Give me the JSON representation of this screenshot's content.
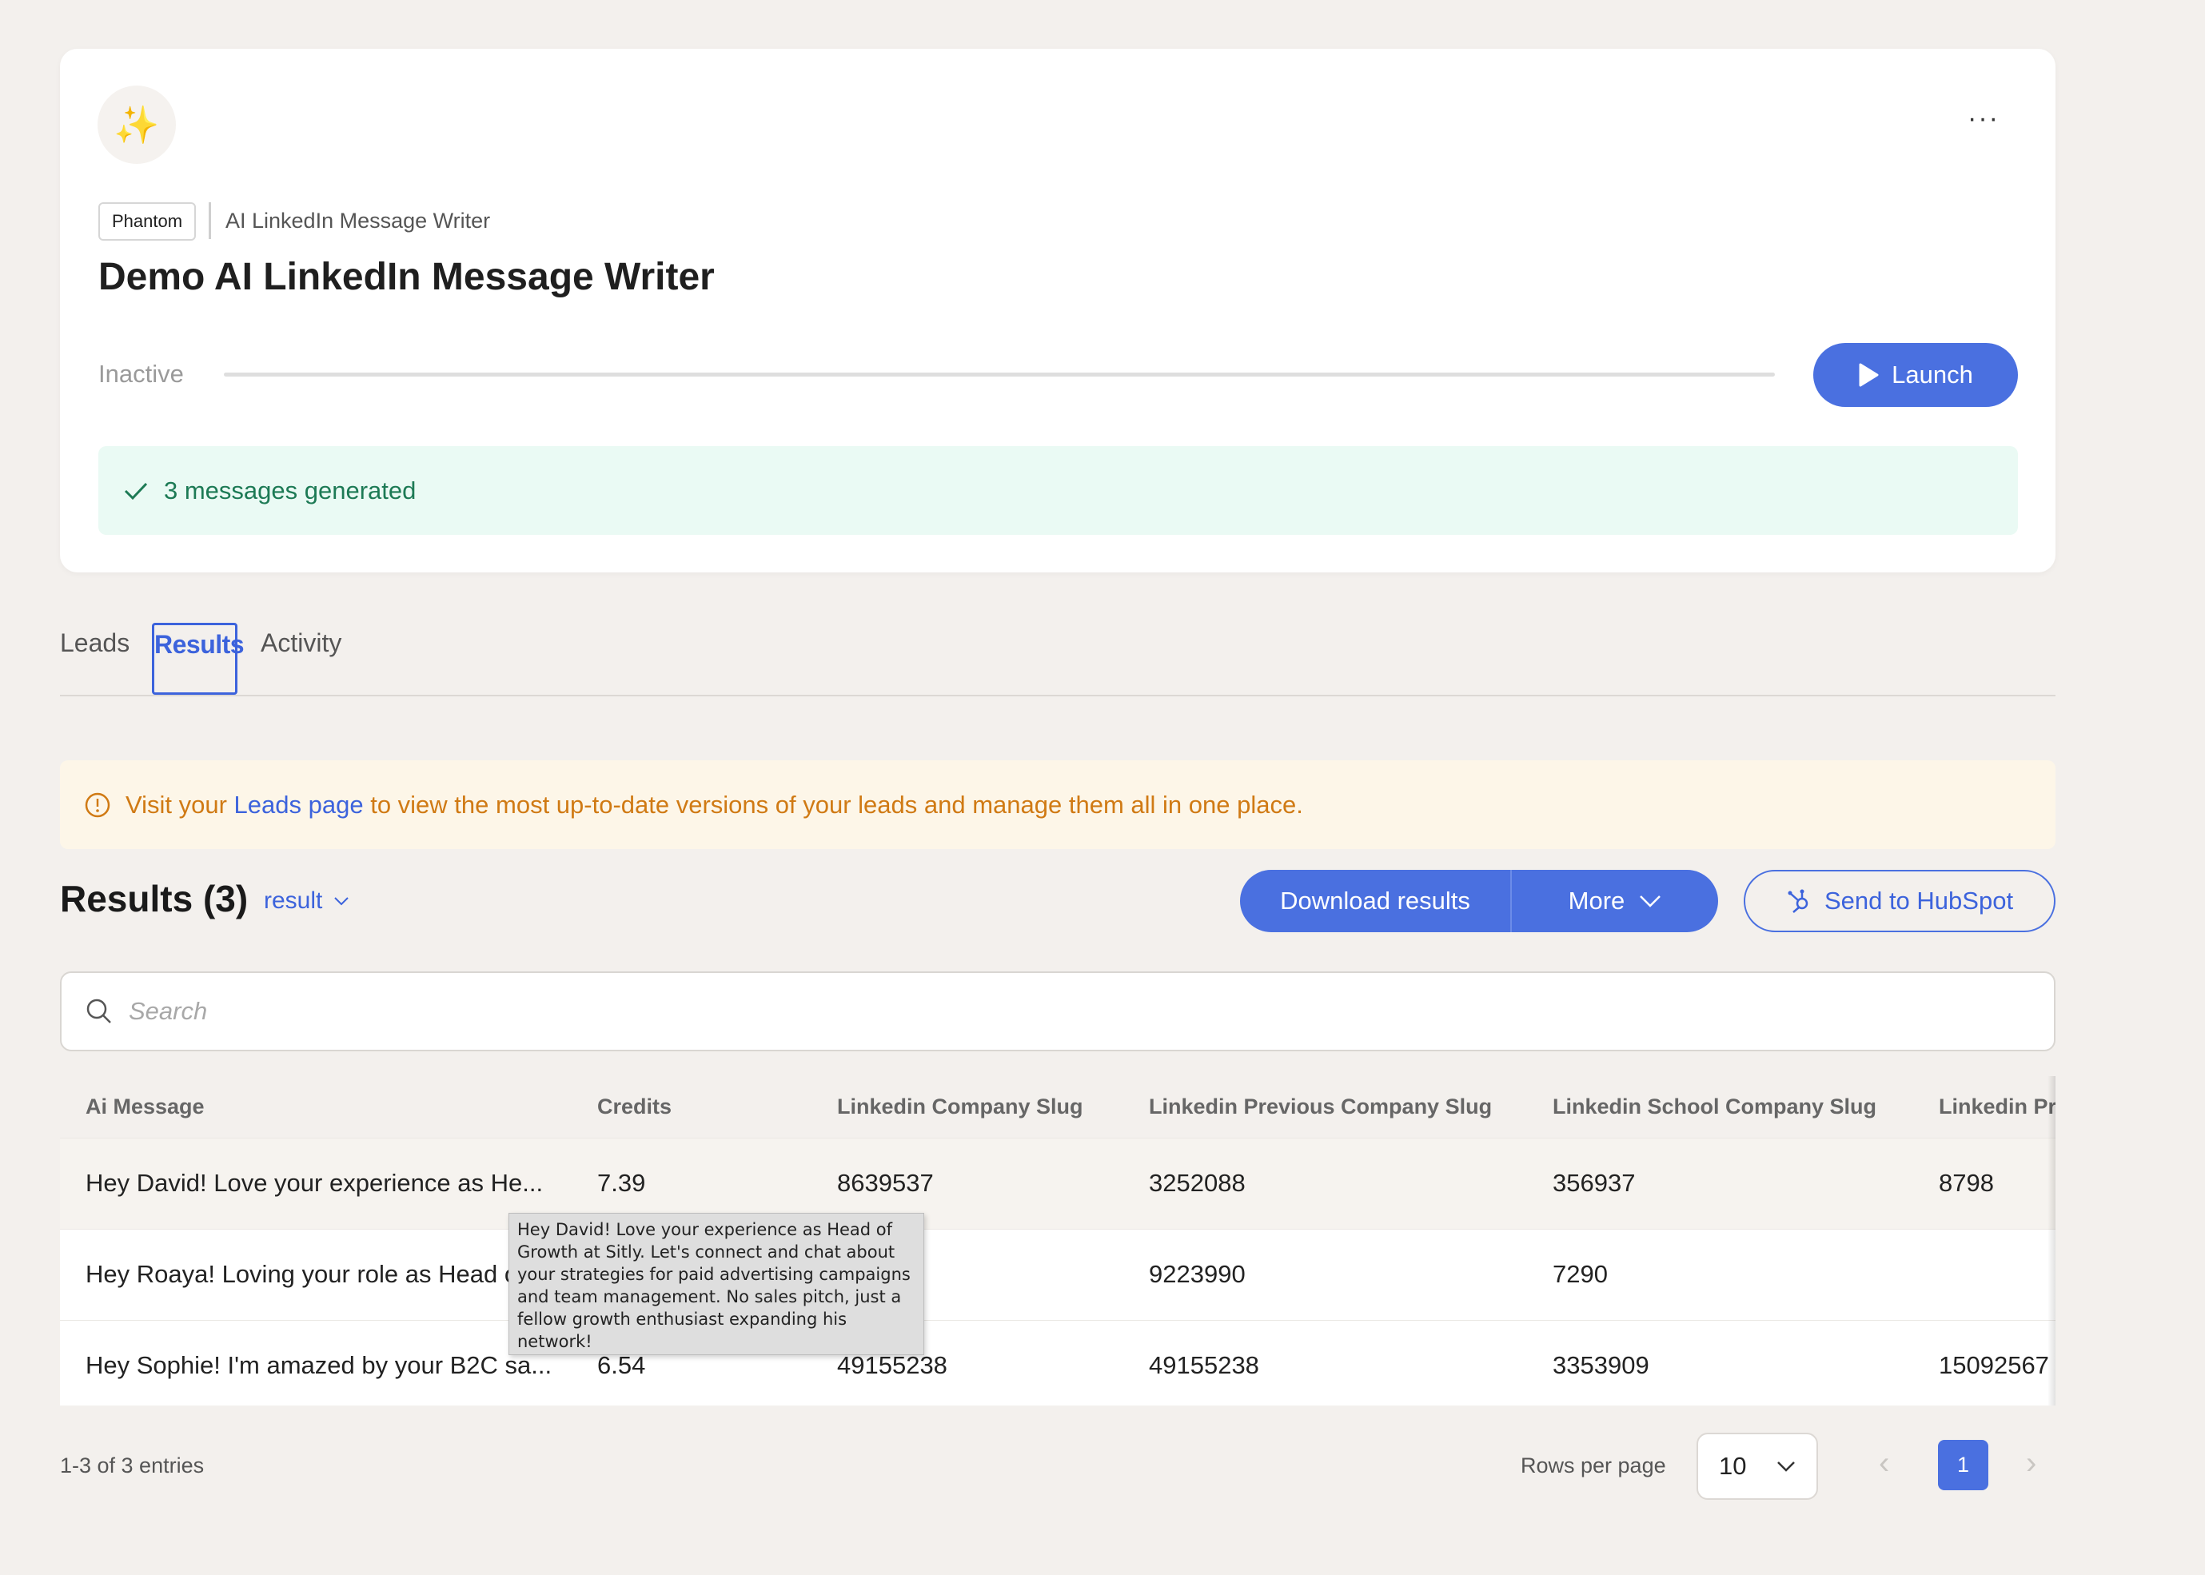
{
  "phantom": {
    "tag": "Phantom",
    "type": "AI LinkedIn Message Writer",
    "title": "Demo AI LinkedIn Message Writer",
    "status": "Inactive",
    "progress": 0,
    "launch_label": "Launch",
    "success_message": "3 messages generated",
    "avatar_emoji": "✨",
    "more_menu": "···"
  },
  "tabs": [
    {
      "label": "Leads",
      "active": false
    },
    {
      "label": "Results",
      "active": true
    },
    {
      "label": "Activity",
      "active": false
    }
  ],
  "notice": {
    "prefix": "Visit your ",
    "link": "Leads page",
    "suffix": " to view the most up-to-date versions of your leads and manage them all in one place."
  },
  "results": {
    "title": "Results (3)",
    "filter": "result",
    "download_label": "Download results",
    "more_label": "More",
    "hubspot_label": "Send to HubSpot"
  },
  "search": {
    "placeholder": "Search",
    "value": ""
  },
  "table": {
    "columns": [
      "Ai Message",
      "Credits",
      "Linkedin Company Slug",
      "Linkedin Previous Company Slug",
      "Linkedin School Company Slug",
      "Linkedin Pre"
    ],
    "rows": [
      [
        "Hey David! Love your experience as He...",
        "7.39",
        "8639537",
        "3252088",
        "356937",
        "8798"
      ],
      [
        "Hey Roaya! Loving your role as Head o",
        "",
        "",
        "9223990",
        "7290",
        ""
      ],
      [
        "Hey Sophie! I'm amazed by your B2C sa...",
        "6.54",
        "49155238",
        "49155238",
        "3353909",
        "15092567"
      ]
    ]
  },
  "tooltip": "Hey David! Love your experience as Head of Growth at Sitly. Let's connect and chat about your strategies for paid advertising campaigns and team management. No sales pitch, just a fellow growth enthusiast expanding his network!",
  "pagination": {
    "entries": "1-3 of 3 entries",
    "rows_per_page_label": "Rows per page",
    "rows_per_page": "10",
    "current_page": "1"
  },
  "colors": {
    "accent": "#4a70e0",
    "success": "#1d7a55",
    "warning": "#d07a14"
  }
}
